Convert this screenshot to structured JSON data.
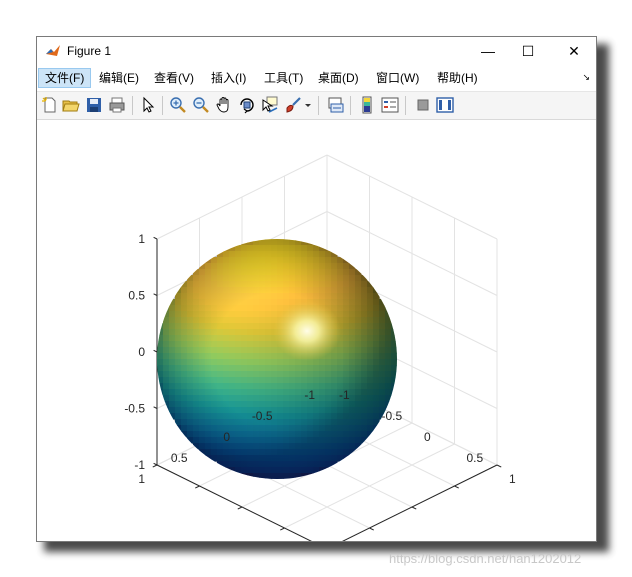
{
  "window": {
    "title": "Figure 1",
    "controls": {
      "minimize": "—",
      "maximize": "☐",
      "close": "✕"
    }
  },
  "menu": {
    "items": [
      "文件(F)",
      "编辑(E)",
      "查看(V)",
      "插入(I)",
      "工具(T)",
      "桌面(D)",
      "窗口(W)",
      "帮助(H)"
    ],
    "active_index": 0,
    "overflow": "↘"
  },
  "toolbar": {
    "icons": [
      "new-figure-icon",
      "open-file-icon",
      "save-icon",
      "print-icon",
      "select-arrow-icon",
      "zoom-in-icon",
      "zoom-out-icon",
      "pan-hand-icon",
      "rotate-3d-icon",
      "data-cursor-icon",
      "brush-icon",
      "dropdown-arrow-icon",
      "link-plot-icon",
      "colorbar-icon",
      "legend-icon",
      "hide-plot-tools-icon",
      "show-plot-tools-icon"
    ]
  },
  "chart_data": {
    "type": "surface",
    "shape": "unit sphere",
    "colormap": "parula",
    "lighting": true,
    "grid": true,
    "axes": {
      "x": {
        "range": [
          -1,
          1
        ],
        "ticks": [
          "1",
          "0.5",
          "0",
          "-0.5",
          "-1"
        ]
      },
      "y": {
        "range": [
          -1,
          1
        ],
        "ticks": [
          "-1",
          "-0.5",
          "0",
          "0.5",
          "1"
        ]
      },
      "z": {
        "range": [
          -1,
          1
        ],
        "ticks": [
          "1",
          "0.5",
          "0",
          "-0.5",
          "-1"
        ]
      }
    }
  },
  "watermark": "https://blog.csdn.net/han1202012"
}
